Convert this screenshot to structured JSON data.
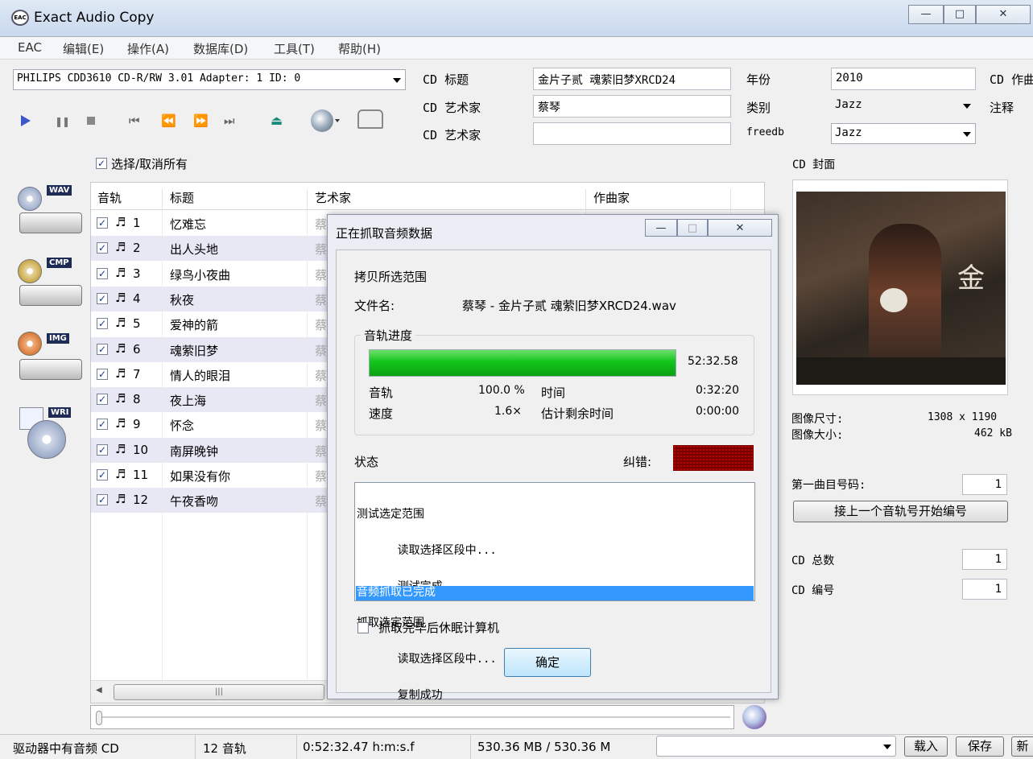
{
  "window": {
    "title": "Exact Audio Copy",
    "minimize": "—",
    "maximize": "□",
    "close": "✕"
  },
  "menu": [
    "EAC",
    "编辑(E)",
    "操作(A)",
    "数据库(D)",
    "工具(T)",
    "帮助(H)"
  ],
  "drive": {
    "selected": "PHILIPS CDD3610 CD-R/RW 3.01  Adapter: 1  ID: 0"
  },
  "cd": {
    "title_label": "CD 标题",
    "title": "金片子贰 魂萦旧梦XRCD24",
    "artist_label": "CD 艺术家",
    "artist": "蔡琴",
    "artist2_label": "CD 艺术家",
    "artist2": "",
    "year_label": "年份",
    "year": "2010",
    "genre_label": "类别",
    "genre": "Jazz",
    "freedb_label": "freedb",
    "freedb": "Jazz",
    "composer_label": "CD 作曲",
    "note_label": "注释"
  },
  "select_all": "选择/取消所有",
  "columns": {
    "track": "音轨",
    "title": "标题",
    "artist": "艺术家",
    "composer": "作曲家"
  },
  "tracks": [
    {
      "num": "1",
      "title": "忆难忘",
      "artist": "蔡"
    },
    {
      "num": "2",
      "title": "出人头地",
      "artist": "蔡"
    },
    {
      "num": "3",
      "title": "绿鸟小夜曲",
      "artist": "蔡"
    },
    {
      "num": "4",
      "title": "秋夜",
      "artist": "蔡"
    },
    {
      "num": "5",
      "title": "爱神的箭",
      "artist": "蔡"
    },
    {
      "num": "6",
      "title": "魂萦旧梦",
      "artist": "蔡"
    },
    {
      "num": "7",
      "title": "情人的眼泪",
      "artist": "蔡"
    },
    {
      "num": "8",
      "title": "夜上海",
      "artist": "蔡"
    },
    {
      "num": "9",
      "title": "怀念",
      "artist": "蔡"
    },
    {
      "num": "10",
      "title": "南屏晚钟",
      "artist": "蔡"
    },
    {
      "num": "11",
      "title": "如果没有你",
      "artist": "蔡"
    },
    {
      "num": "12",
      "title": "午夜香吻",
      "artist": "蔡"
    }
  ],
  "sidebar": [
    "WAV",
    "CMP",
    "IMG",
    "WRI"
  ],
  "cover": {
    "label": "CD 封面",
    "size_label": "图像尺寸:",
    "size": "1308 x 1190",
    "filesize_label": "图像大小:",
    "filesize": "462 kB"
  },
  "first_track": {
    "label": "第一曲目号码:",
    "value": "1",
    "button": "接上一个音轨号开始编号"
  },
  "cd_total": {
    "label": "CD 总数",
    "value": "1"
  },
  "cd_number": {
    "label": "CD 编号",
    "value": "1"
  },
  "dialog": {
    "title": "正在抓取音频数据",
    "mode": "拷贝所选范围",
    "filename_label": "文件名:",
    "filename": "蔡琴 - 金片子贰 魂萦旧梦XRCD24.wav",
    "group": "音轨进度",
    "progress": 1.0,
    "total_time": "52:32.58",
    "track_label": "音轨",
    "track_pct": "100.0 %",
    "time_label": "时间",
    "time": "0:32:20",
    "speed_label": "速度",
    "speed": "1.6×",
    "remain_label": "估计剩余时间",
    "remain": "0:00:00",
    "status_label": "状态",
    "correction_label": "纠错:",
    "log": [
      "测试选定范围",
      "      读取选择区段中...",
      "      测试完成",
      "抓取选定范围",
      "      读取选择区段中...",
      "      复制成功"
    ],
    "log_selected": "音频抓取已完成",
    "hibernate": "抓取完毕后休眠计算机",
    "ok": "确定"
  },
  "status": {
    "audio": "驱动器中有音频 CD",
    "tracks": "12 音轨",
    "length": "0:52:32.47 h:m:s.f",
    "size": "530.36 MB / 530.36 M"
  },
  "buttons": {
    "load": "载入",
    "save": "保存",
    "new": "新"
  },
  "colors": {
    "progress": "#12c51b",
    "selection": "#3399ff",
    "play": "#3a58c8"
  }
}
